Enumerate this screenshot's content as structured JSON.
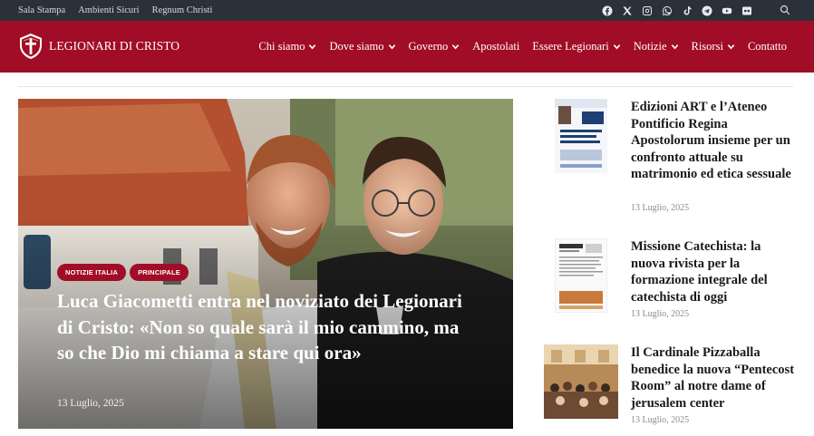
{
  "topbar": {
    "links": [
      "Sala Stampa",
      "Ambienti Sicuri",
      "Regnum Christi"
    ],
    "social_icons": [
      "facebook-icon",
      "x-icon",
      "instagram-icon",
      "whatsapp-icon",
      "tiktok-icon",
      "telegram-icon",
      "youtube-icon",
      "flickr-icon"
    ],
    "search_icon": "search-icon"
  },
  "header": {
    "logo_text": "LEGIONARI DI CRISTO",
    "nav": [
      {
        "label": "Chi siamo",
        "has_dropdown": true
      },
      {
        "label": "Dove siamo",
        "has_dropdown": true
      },
      {
        "label": "Governo",
        "has_dropdown": true
      },
      {
        "label": "Apostolati",
        "has_dropdown": false
      },
      {
        "label": "Essere Legionari",
        "has_dropdown": true
      },
      {
        "label": "Notizie",
        "has_dropdown": true
      },
      {
        "label": "Risorsi",
        "has_dropdown": true
      },
      {
        "label": "Contatto",
        "has_dropdown": false
      }
    ]
  },
  "hero": {
    "badges": [
      "NOTIZIE ITALIA",
      "PRINCIPALE"
    ],
    "title": "Luca Giacometti entra nel noviziato dei Legionari di Cristo: «Non so quale sarà il mio cammino, ma so che Dio mi chiama a stare qui ora»",
    "date": "13 Luglio, 2025"
  },
  "side_articles": [
    {
      "title": "Edizioni ART e l’Ateneo Pontificio Regina Apostolorum insieme per un confronto attuale su matrimonio ed etica sessuale",
      "date": "13 Luglio, 2025"
    },
    {
      "title": "Missione Catechista: la nuova rivista per la formazione integrale del catechista di oggi",
      "date": "13 Luglio, 2025"
    },
    {
      "title": "Il Cardinale Pizzaballa benedice la nuova “Pentecost Room” al notre dame of jerusalem center",
      "date": "13 Luglio, 2025"
    }
  ],
  "colors": {
    "brand_red": "#a10d26",
    "topbar": "#2b313b"
  }
}
